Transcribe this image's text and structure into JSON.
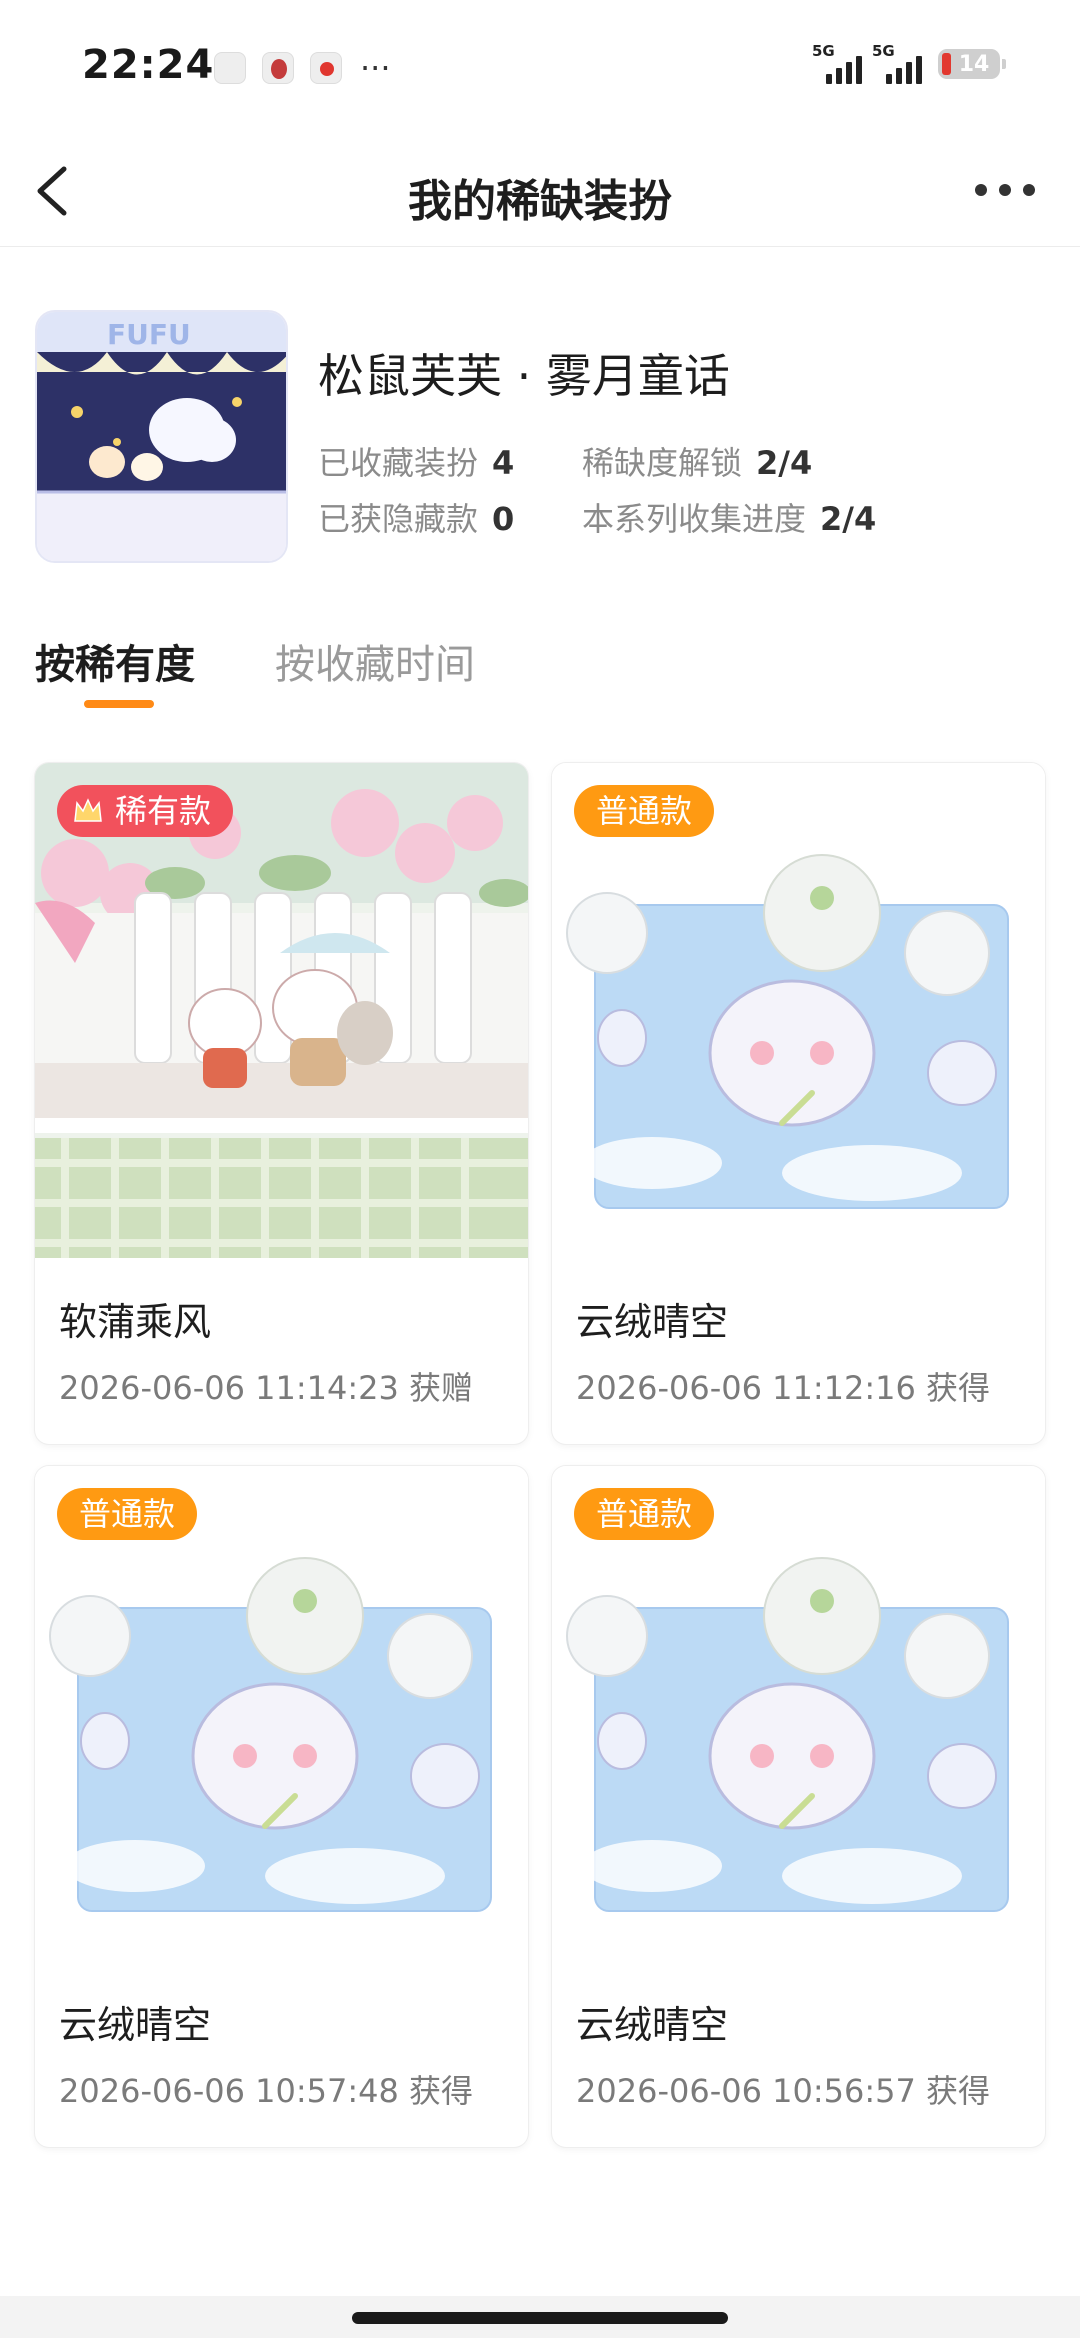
{
  "status_bar": {
    "time": "22:24",
    "more": "···",
    "signal_1": "5G",
    "signal_2": "5G",
    "battery": "14"
  },
  "nav": {
    "title": "我的稀缺装扮"
  },
  "series": {
    "name": "松鼠芙芙 · 雾月童话",
    "collected_label": "已收藏装扮",
    "collected_value": "4",
    "rarity_label": "稀缺度解锁",
    "rarity_value": "2/4",
    "hidden_label": "已获隐藏款",
    "hidden_value": "0",
    "progress_label": "本系列收集进度",
    "progress_value": "2/4"
  },
  "tabs": [
    {
      "label": "按稀有度",
      "active": true
    },
    {
      "label": "按收藏时间",
      "active": false
    }
  ],
  "items": [
    {
      "badge": "稀有款",
      "title": "软蒲乘风",
      "meta": "2026-06-06 11:14:23 获赠"
    },
    {
      "badge": "普通款",
      "title": "云绒晴空",
      "meta": "2026-06-06 11:12:16 获得"
    },
    {
      "badge": "普通款",
      "title": "云绒晴空",
      "meta": "2026-06-06 10:57:48 获得"
    },
    {
      "badge": "普通款",
      "title": "云绒晴空",
      "meta": "2026-06-06 10:56:57 获得"
    }
  ],
  "colors": {
    "accent": "#ff8a16",
    "rare_badge": "#f2515c",
    "normal_badge": "#ff9a12"
  }
}
